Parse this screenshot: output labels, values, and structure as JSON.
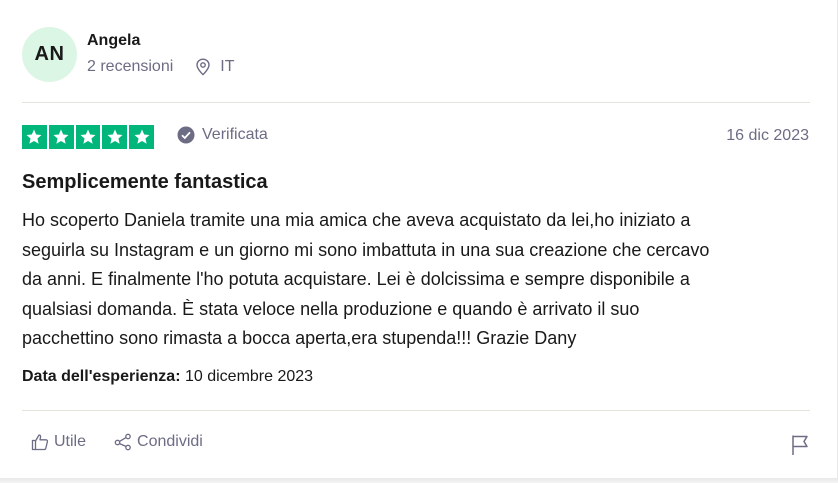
{
  "reviewer": {
    "initials": "AN",
    "name": "Angela",
    "reviews_count": "2 recensioni",
    "country": "IT"
  },
  "review": {
    "rating": 5,
    "rating_color": "#00b67a",
    "verified_label": "Verificata",
    "date": "16 dic 2023",
    "title": "Semplicemente fantastica",
    "body_lines": [
      "Ho scoperto Daniela tramite una mia amica che aveva acquistato da lei,ho iniziato a",
      "seguirla su Instagram e un giorno mi sono imbattuta in una sua creazione che cercavo",
      "da anni. E finalmente l'ho potuta acquistare. Lei è dolcissima e sempre disponibile a",
      "qualsiasi domanda. È stata veloce nella produzione e quando è arrivato il suo",
      "pacchettino sono rimasta a bocca aperta,era stupenda!!! Grazie Dany"
    ],
    "experience_label": "Data dell'esperienza:",
    "experience_date": "10 dicembre 2023"
  },
  "actions": {
    "useful_label": "Utile",
    "share_label": "Condividi"
  },
  "icons": {
    "location": "location-pin-icon",
    "verified": "check-circle-icon",
    "useful": "thumbs-up-icon",
    "share": "share-icon",
    "report": "flag-icon"
  }
}
